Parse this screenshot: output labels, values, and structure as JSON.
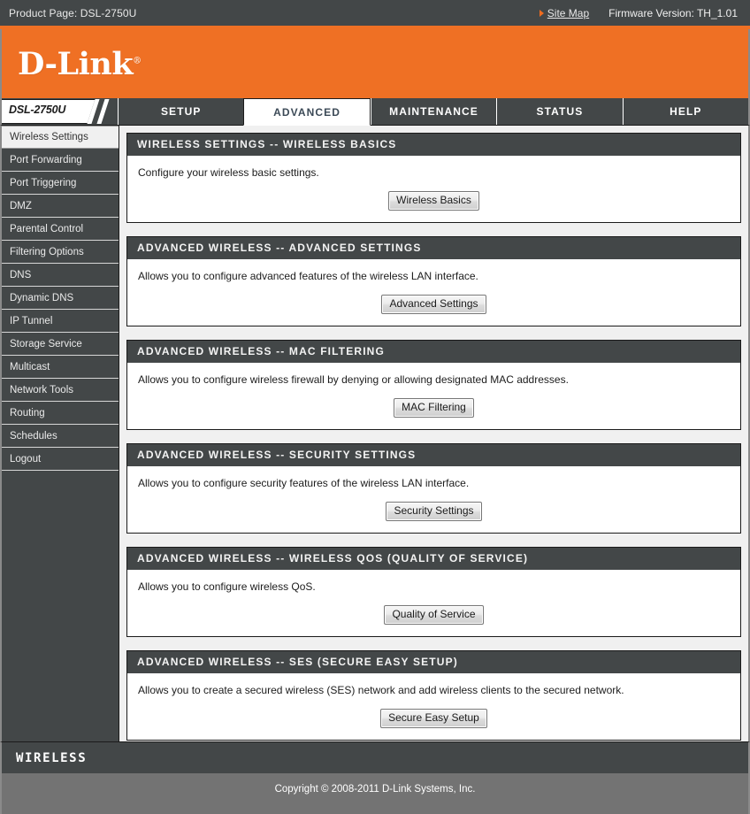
{
  "topbar": {
    "product_label": "Product Page: DSL-2750U",
    "sitemap_label": "Site Map",
    "firmware_label": "Firmware Version: TH_1.01"
  },
  "brand": {
    "name": "D-Link",
    "registered_mark": "®",
    "accent_color": "#ef7024",
    "dark_color": "#434748"
  },
  "navigation": {
    "model_tab": "DSL-2750U",
    "tabs": [
      {
        "label": "SETUP",
        "active": false
      },
      {
        "label": "ADVANCED",
        "active": true
      },
      {
        "label": "MAINTENANCE",
        "active": false
      },
      {
        "label": "STATUS",
        "active": false
      },
      {
        "label": "HELP",
        "active": false
      }
    ]
  },
  "sidebar": {
    "items": [
      {
        "label": "Wireless Settings",
        "active": true
      },
      {
        "label": "Port Forwarding",
        "active": false
      },
      {
        "label": "Port Triggering",
        "active": false
      },
      {
        "label": "DMZ",
        "active": false
      },
      {
        "label": "Parental Control",
        "active": false
      },
      {
        "label": "Filtering Options",
        "active": false
      },
      {
        "label": "DNS",
        "active": false
      },
      {
        "label": "Dynamic DNS",
        "active": false
      },
      {
        "label": "IP Tunnel",
        "active": false
      },
      {
        "label": "Storage Service",
        "active": false
      },
      {
        "label": "Multicast",
        "active": false
      },
      {
        "label": "Network Tools",
        "active": false
      },
      {
        "label": "Routing",
        "active": false
      },
      {
        "label": "Schedules",
        "active": false
      },
      {
        "label": "Logout",
        "active": false
      }
    ]
  },
  "main": {
    "panels": [
      {
        "title": "WIRELESS SETTINGS -- WIRELESS BASICS",
        "description": "Configure your wireless basic settings.",
        "button": "Wireless Basics"
      },
      {
        "title": "ADVANCED WIRELESS -- ADVANCED SETTINGS",
        "description": "Allows you to configure advanced features of the wireless LAN interface.",
        "button": "Advanced Settings"
      },
      {
        "title": "ADVANCED WIRELESS -- MAC FILTERING",
        "description": "Allows you to configure wireless firewall by denying or allowing designated MAC addresses.",
        "button": "MAC Filtering"
      },
      {
        "title": "ADVANCED WIRELESS -- SECURITY SETTINGS",
        "description": "Allows you to configure security features of the wireless LAN interface.",
        "button": "Security Settings"
      },
      {
        "title": "ADVANCED WIRELESS -- WIRELESS QOS (QUALITY OF SERVICE)",
        "description": "Allows you to configure wireless QoS.",
        "button": "Quality of Service"
      },
      {
        "title": "ADVANCED WIRELESS -- SES (SECURE EASY SETUP)",
        "description": "Allows you to create a secured wireless (SES) network and add wireless clients to the secured network.",
        "button": "Secure Easy Setup"
      }
    ]
  },
  "footer": {
    "section_label": "WIRELESS",
    "copyright": "Copyright © 2008-2011 D-Link Systems, Inc."
  }
}
